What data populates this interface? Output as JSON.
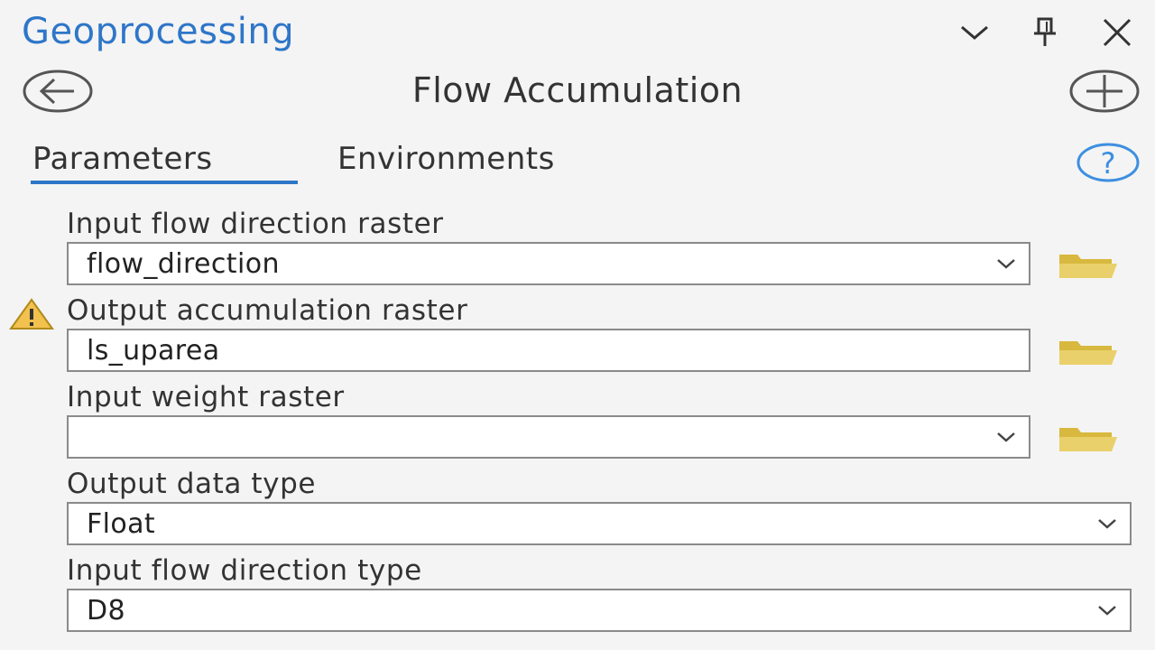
{
  "pane": {
    "title": "Geoprocessing",
    "controls": [
      "chevron-down-icon",
      "pin-icon",
      "close-icon"
    ]
  },
  "tool": {
    "title": "Flow Accumulation",
    "back_icon": "back-arrow-icon",
    "add_icon": "add-icon"
  },
  "tabs": {
    "parameters": "Parameters",
    "environments": "Environments",
    "active": "Parameters",
    "help_icon": "help-icon"
  },
  "params": {
    "in_flow_dir": {
      "label": "Input flow direction raster",
      "value": "flow_direction"
    },
    "out_accum": {
      "label": "Output accumulation raster",
      "value": "ls_uparea",
      "warning_icon": "warning-icon"
    },
    "in_weight": {
      "label": "Input weight raster",
      "value": ""
    },
    "out_data_type": {
      "label": "Output data type",
      "value": "Float"
    },
    "flow_dir_type": {
      "label": "Input flow direction type",
      "value": "D8"
    }
  },
  "colors": {
    "accent": "#2e76c8",
    "folder": "#e3c95a",
    "warning": "#f2c14e",
    "background": "#f4f4f4"
  }
}
